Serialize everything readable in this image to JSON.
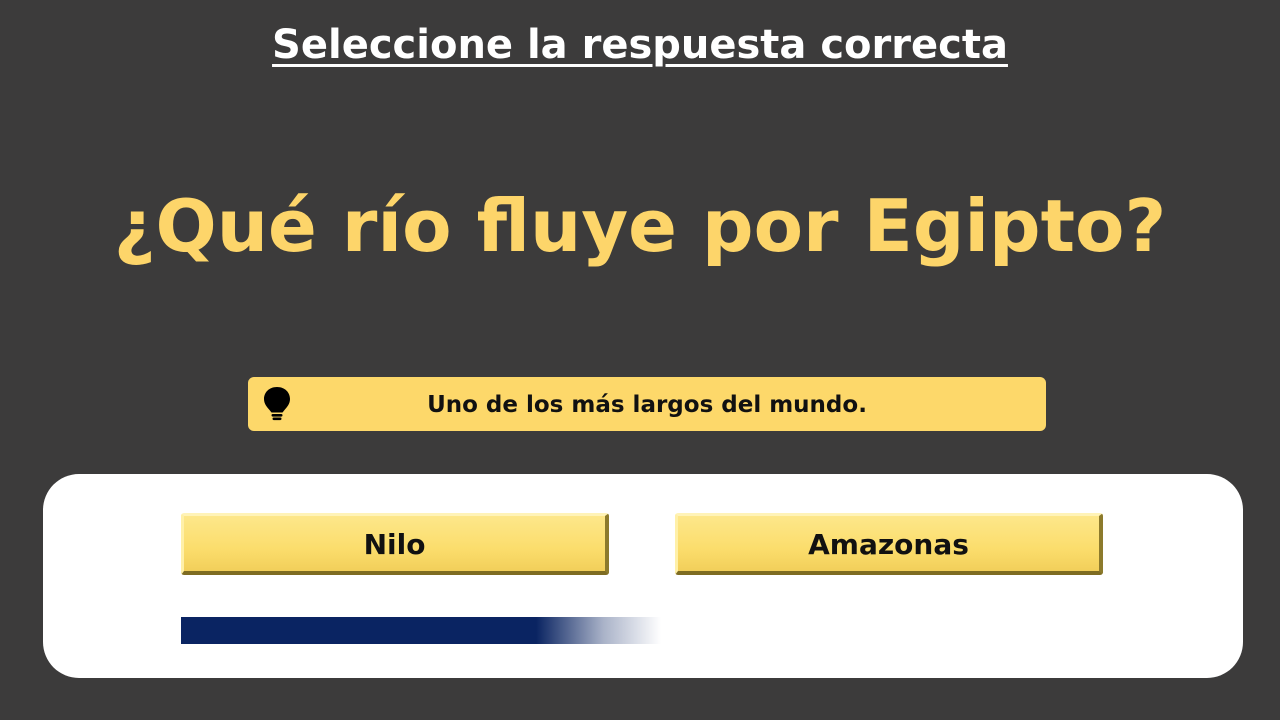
{
  "instruction": "Seleccione la respuesta correcta",
  "question": "¿Qué río fluye por Egipto?",
  "hint": {
    "icon": "lightbulb-icon",
    "text": "Uno de los más largos del mundo."
  },
  "options": [
    {
      "label": "Nilo"
    },
    {
      "label": "Amazonas"
    }
  ],
  "timer": {
    "progress": 1.0
  },
  "colors": {
    "background": "#3c3b3b",
    "question": "#fdd56a",
    "hint_bar": "#fdd86a",
    "option_button": "#fbdd6c",
    "timer_bar": "#0a2462",
    "panel": "#ffffff"
  }
}
